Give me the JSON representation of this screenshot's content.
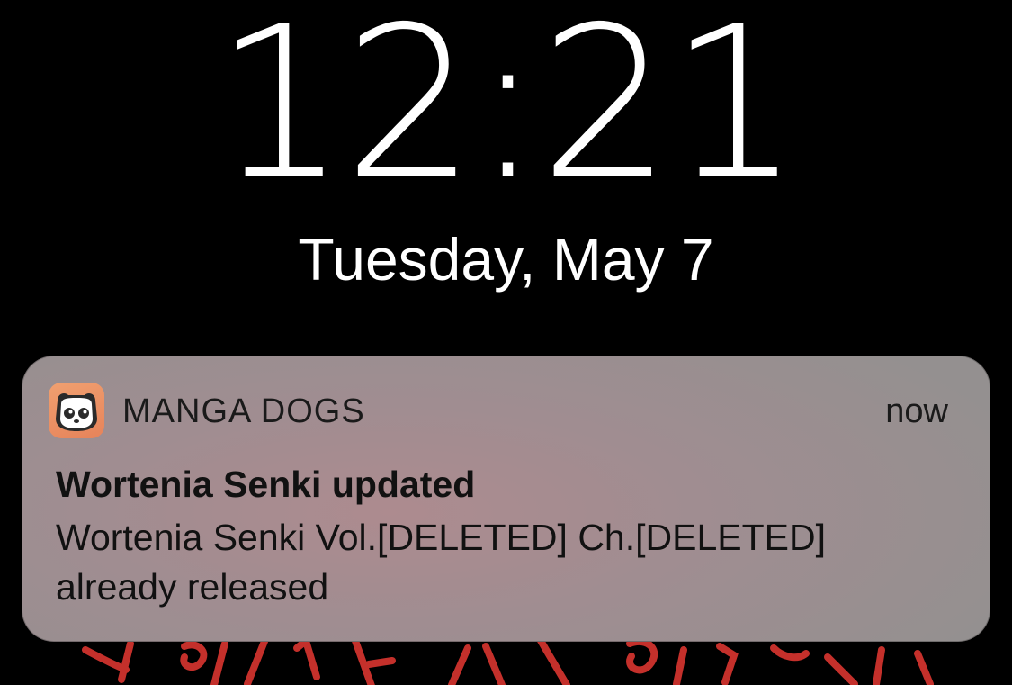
{
  "lock_screen": {
    "time": "12:21",
    "date": "Tuesday, May 7",
    "wallpaper": {
      "accent_color": "#c4302b",
      "background_color": "#000000"
    }
  },
  "notification": {
    "app_icon": "manga-dogs-app-icon",
    "app_name": "MANGA DOGS",
    "time_ago": "now",
    "title": "Wortenia Senki updated",
    "body": "Wortenia Senki Vol.[DELETED] Ch.[DELETED] already released"
  }
}
